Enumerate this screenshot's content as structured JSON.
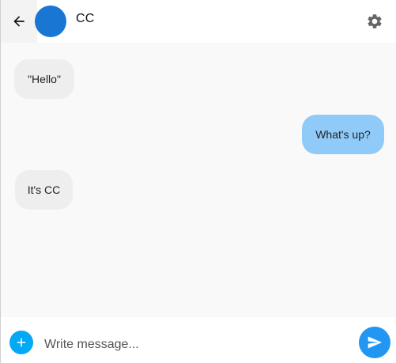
{
  "header": {
    "back_icon": "arrow-back-icon",
    "contact_name": "CC",
    "avatar_color": "#1976d2",
    "settings_icon": "gear-icon"
  },
  "messages": [
    {
      "direction": "incoming",
      "text": "\"Hello\""
    },
    {
      "direction": "outgoing",
      "text": "What's up?"
    },
    {
      "direction": "incoming",
      "text": "It's CC"
    }
  ],
  "composer": {
    "add_icon": "plus-icon",
    "placeholder": "Write message...",
    "value": "",
    "send_icon": "send-icon"
  },
  "colors": {
    "incoming_bubble": "#eeeeee",
    "outgoing_bubble": "#90caf9",
    "accent": "#2196f3",
    "add_button": "#03a9f4"
  }
}
